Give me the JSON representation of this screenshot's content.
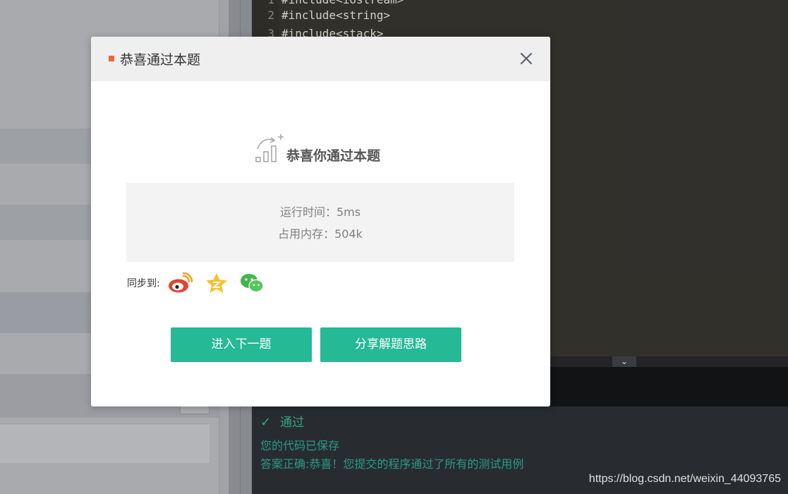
{
  "editor": {
    "lines": [
      {
        "num": "1",
        "text": "#include<iostream>"
      },
      {
        "num": "2",
        "text": "#include<string>"
      },
      {
        "num": "3",
        "text": "#include<stack>"
      }
    ]
  },
  "toggle": {
    "icon": "chevron-down-icon",
    "glyph": "⌄"
  },
  "console": {
    "status": "通过",
    "check_glyph": "✓",
    "saved_msg": "您的代码已保存",
    "result_msg": "答案正确:恭喜！您提交的程序通过了所有的测试用例"
  },
  "watermark": "https://blog.csdn.net/weixin_44093765",
  "modal": {
    "title": "恭喜通过本题",
    "hero_text": "恭喜你通过本题",
    "run_time": "运行时间：5ms",
    "memory": "占用内存：504k",
    "share_label": "同步到:",
    "share_targets": [
      "weibo-icon",
      "qzone-icon",
      "wechat-icon"
    ],
    "next_button": "进入下一题",
    "share_button": "分享解题思路"
  },
  "colors": {
    "accent": "#26b996",
    "title_mark": "#f4623a",
    "console_text": "#2aa089"
  }
}
